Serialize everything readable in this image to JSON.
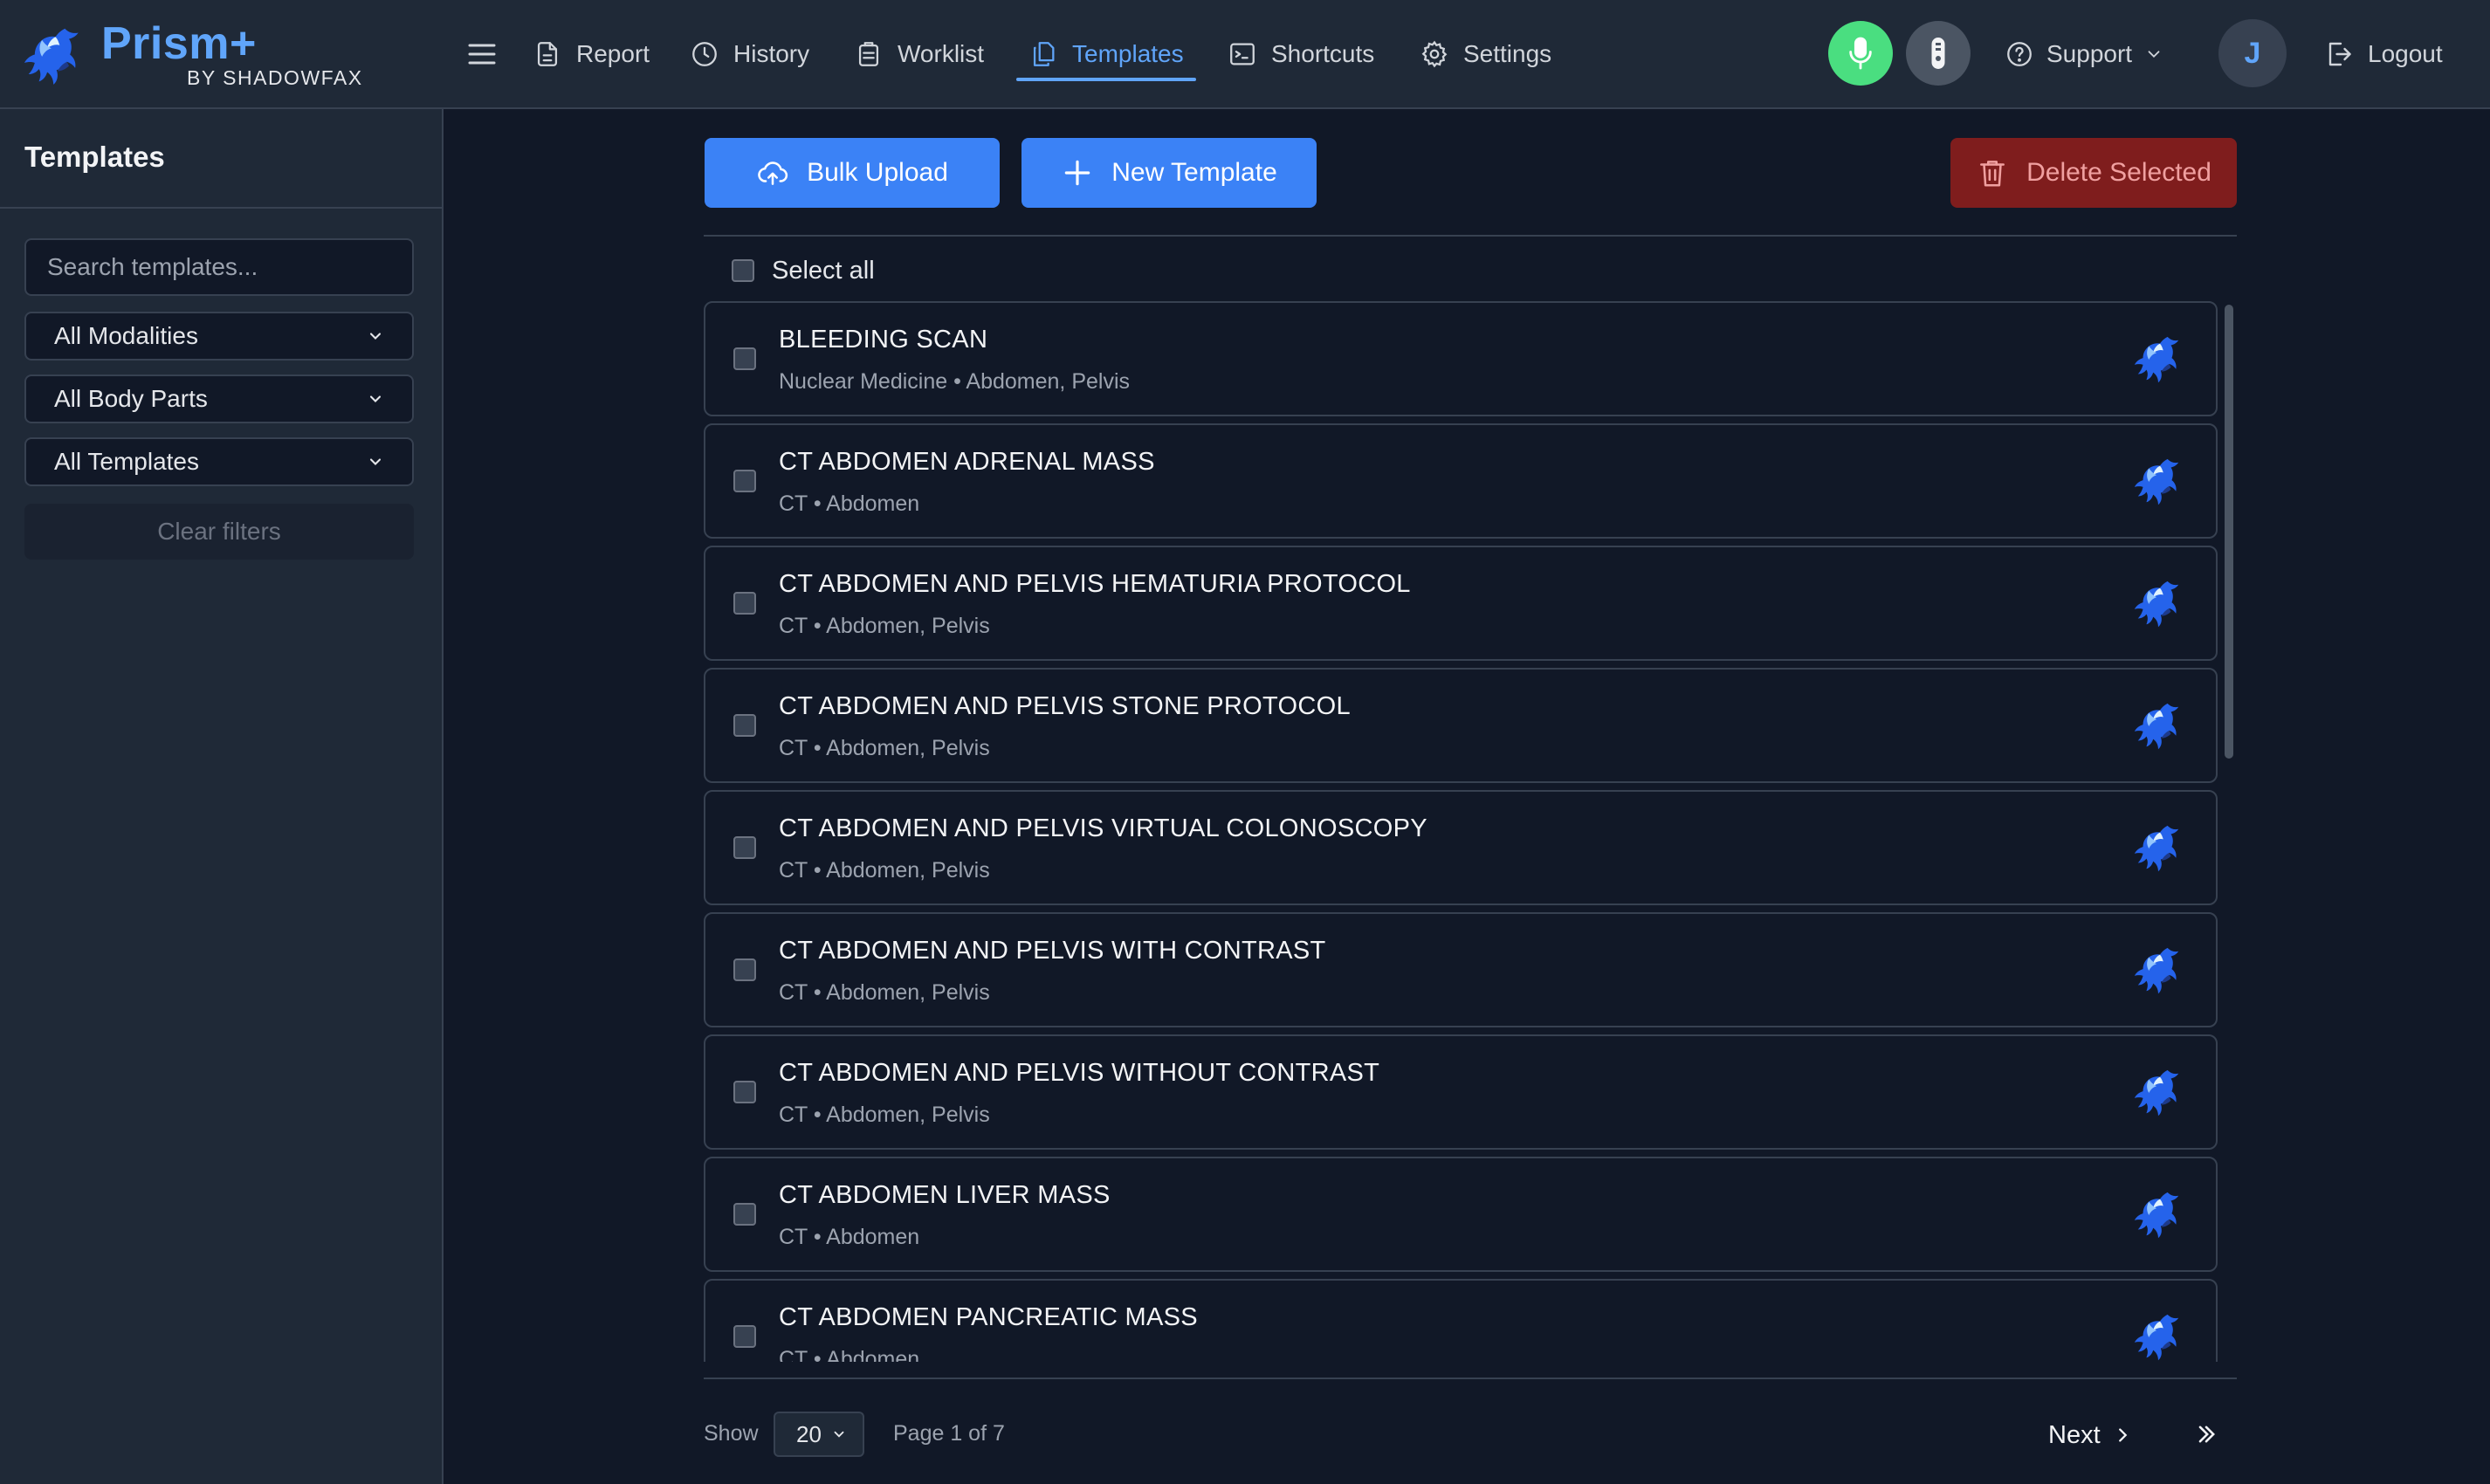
{
  "brand": {
    "title": "Prism+",
    "subtitle": "BY SHADOWFAX"
  },
  "nav": {
    "items": [
      {
        "label": "Report",
        "icon": "document-icon"
      },
      {
        "label": "History",
        "icon": "clock-icon"
      },
      {
        "label": "Worklist",
        "icon": "clipboard-icon"
      },
      {
        "label": "Templates",
        "icon": "copy-icon",
        "active": true
      },
      {
        "label": "Shortcuts",
        "icon": "terminal-icon"
      },
      {
        "label": "Settings",
        "icon": "gear-icon"
      }
    ],
    "support_label": "Support",
    "avatar_initial": "J",
    "logout_label": "Logout"
  },
  "sidebar": {
    "title": "Templates",
    "search_placeholder": "Search templates...",
    "modality_filter": "All Modalities",
    "body_part_filter": "All Body Parts",
    "template_filter": "All Templates",
    "clear_filters_label": "Clear filters"
  },
  "toolbar": {
    "bulk_upload_label": "Bulk Upload",
    "new_template_label": "New Template",
    "delete_selected_label": "Delete Selected",
    "select_all_label": "Select all"
  },
  "templates": [
    {
      "title": "BLEEDING SCAN",
      "modality": "Nuclear Medicine",
      "body_parts": "Abdomen, Pelvis"
    },
    {
      "title": "CT ABDOMEN ADRENAL MASS",
      "modality": "CT",
      "body_parts": "Abdomen"
    },
    {
      "title": "CT ABDOMEN AND PELVIS HEMATURIA PROTOCOL",
      "modality": "CT",
      "body_parts": "Abdomen, Pelvis"
    },
    {
      "title": "CT ABDOMEN AND PELVIS STONE PROTOCOL",
      "modality": "CT",
      "body_parts": "Abdomen, Pelvis"
    },
    {
      "title": "CT ABDOMEN AND PELVIS VIRTUAL COLONOSCOPY",
      "modality": "CT",
      "body_parts": "Abdomen, Pelvis"
    },
    {
      "title": "CT ABDOMEN AND PELVIS WITH CONTRAST",
      "modality": "CT",
      "body_parts": "Abdomen, Pelvis"
    },
    {
      "title": "CT ABDOMEN AND PELVIS WITHOUT CONTRAST",
      "modality": "CT",
      "body_parts": "Abdomen, Pelvis"
    },
    {
      "title": "CT ABDOMEN LIVER MASS",
      "modality": "CT",
      "body_parts": "Abdomen"
    },
    {
      "title": "CT ABDOMEN PANCREATIC MASS",
      "modality": "CT",
      "body_parts": "Abdomen"
    }
  ],
  "pagination": {
    "show_label": "Show",
    "page_size": "20",
    "page_info": "Page 1 of 7",
    "next_label": "Next"
  },
  "colors": {
    "accent": "#60a5fa",
    "primary_button": "#3b82f6",
    "danger_button": "#7f1d1d",
    "mic_active": "#4ade80",
    "background": "#111827",
    "panel": "#1f2937"
  }
}
